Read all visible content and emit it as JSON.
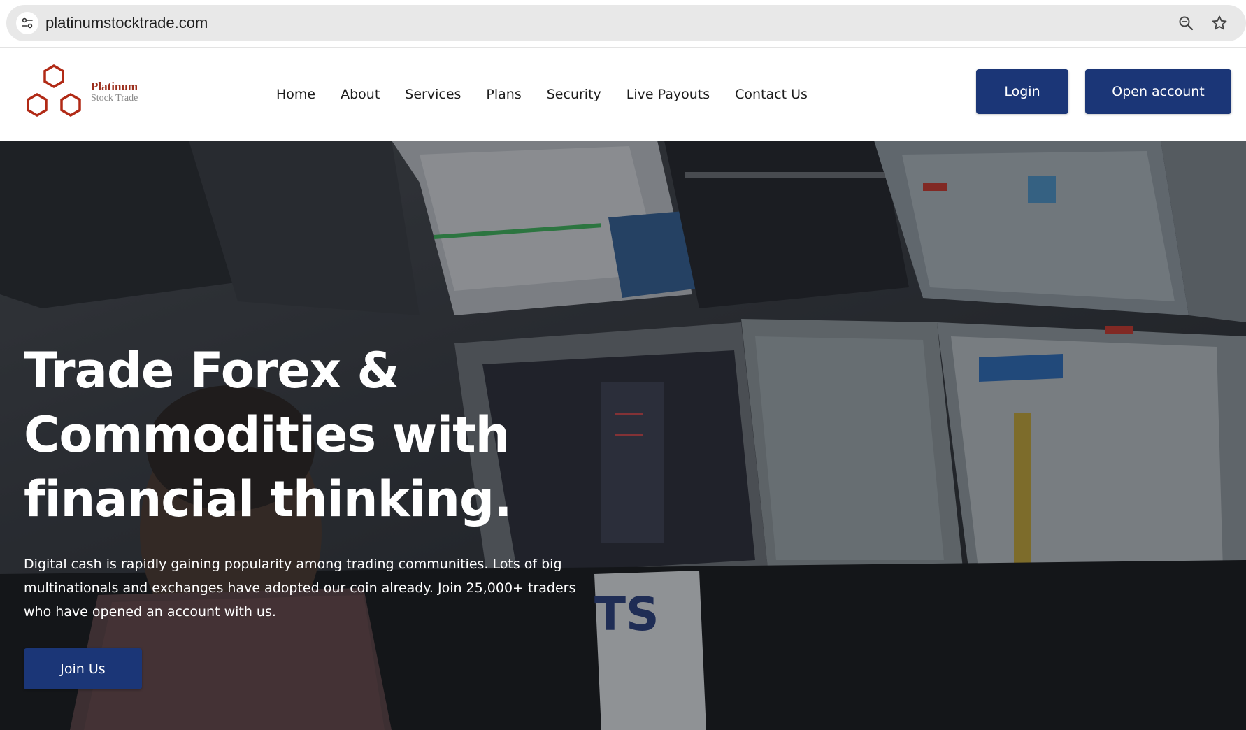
{
  "browser": {
    "url": "platinumstocktrade.com",
    "icons": [
      "site-info-icon",
      "zoom-icon",
      "bookmark-star-icon"
    ]
  },
  "header": {
    "logo": {
      "title": "Platinum",
      "subtitle": "Stock Trade",
      "color": "#9b2d1b"
    },
    "nav": [
      {
        "label": "Home"
      },
      {
        "label": "About"
      },
      {
        "label": "Services"
      },
      {
        "label": "Plans"
      },
      {
        "label": "Security"
      },
      {
        "label": "Live Payouts"
      },
      {
        "label": "Contact Us"
      }
    ],
    "login_label": "Login",
    "open_account_label": "Open account",
    "button_color": "#1b3677"
  },
  "hero": {
    "title": "Trade Forex & Commodities with financial thinking.",
    "description": "Digital cash is rapidly gaining popularity among trading communities. Lots of big multinationals and exchanges have adopted our coin already. Join 25,000+ traders who have opened an account with us.",
    "cta_label": "Join Us",
    "background_image": "trader at multiple monitors photo"
  }
}
